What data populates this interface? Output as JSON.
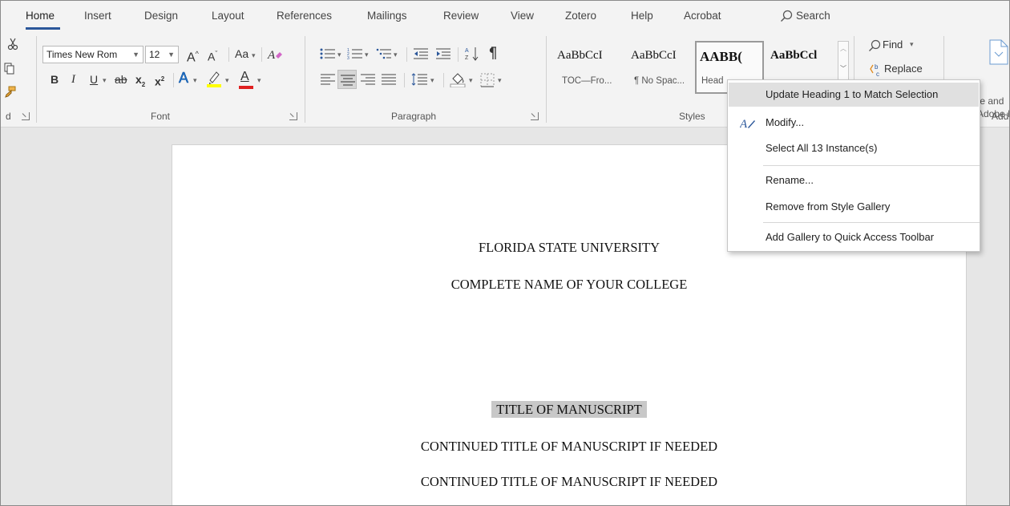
{
  "menu_tabs": [
    {
      "label": "Home",
      "active": true
    },
    {
      "label": "Insert"
    },
    {
      "label": "Design"
    },
    {
      "label": "Layout"
    },
    {
      "label": "References"
    },
    {
      "label": "Mailings"
    },
    {
      "label": "Review"
    },
    {
      "label": "View"
    },
    {
      "label": "Zotero"
    },
    {
      "label": "Help"
    },
    {
      "label": "Acrobat"
    }
  ],
  "search_label": "Search",
  "ribbon": {
    "font": {
      "group_label": "Font",
      "font_name": "Times New Rom",
      "font_size": "12",
      "grow": "A",
      "shrink": "A",
      "change_case": "Aa",
      "bold": "B",
      "italic": "I",
      "underline": "U",
      "strike": "ab",
      "subscript": "x",
      "superscript": "x",
      "effects": "A",
      "font_color": "A"
    },
    "paragraph": {
      "group_label": "Paragraph"
    },
    "styles": {
      "group_label": "Styles",
      "items": [
        {
          "sample": "AaBbCcI",
          "name": "TOC—Fro..."
        },
        {
          "sample": "AaBbCcI",
          "name": "¶ No Spac..."
        },
        {
          "sample": "AABB(",
          "name": "Head"
        },
        {
          "sample": "AaBbCcl",
          "name": ""
        }
      ]
    },
    "editing": {
      "find": "Find",
      "replace": "Replace"
    },
    "adobe": {
      "line1": "Create and",
      "line2": "Adobe I",
      "label": "Add"
    },
    "clipboard": {
      "label": "d"
    }
  },
  "colors": {
    "accent": "#2b579a",
    "highlight": "#ffff00",
    "font_color": "#e02020",
    "selection": "#c8c8c8"
  },
  "context_menu": {
    "items": [
      {
        "label": "Update Heading 1 to Match Selection",
        "hover": true
      },
      {
        "label": "Modify..."
      },
      {
        "label": "Select All 13 Instance(s)"
      },
      {
        "label": "Rename..."
      },
      {
        "label": "Remove from Style Gallery"
      },
      {
        "label": "Add Gallery to Quick Access Toolbar"
      }
    ]
  },
  "document": {
    "lines": [
      "FLORIDA STATE UNIVERSITY",
      "COMPLETE NAME OF YOUR COLLEGE",
      "TITLE OF MANUSCRIPT",
      "CONTINUED TITLE OF MANUSCRIPT IF NEEDED",
      "CONTINUED TITLE OF MANUSCRIPT IF NEEDED"
    ]
  }
}
